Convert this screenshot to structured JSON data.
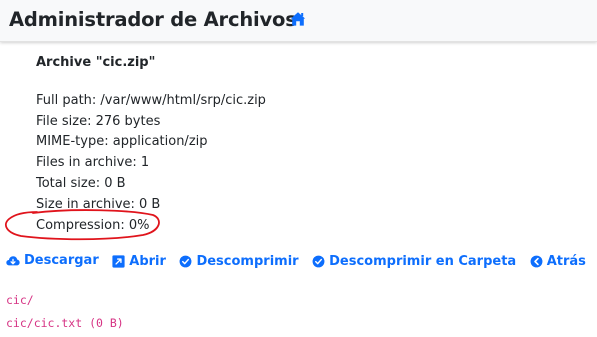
{
  "header": {
    "brand": "Administrador de Archivos",
    "home_icon": "home-icon",
    "accent_color": "#0d6efd"
  },
  "archive": {
    "title": "Archive \"cic.zip\"",
    "info": [
      "Full path: /var/www/html/srp/cic.zip",
      "File size: 276 bytes",
      "MIME-type: application/zip",
      "Files in archive: 1",
      "Total size: 0 B",
      "Size in archive: 0 B",
      "Compression: 0%"
    ]
  },
  "annotation": {
    "shape": "hand-drawn-ellipse",
    "color": "#e0141c",
    "target": "Compression: 0%"
  },
  "actions": [
    {
      "label": "Descargar",
      "icon": "cloud-download-icon"
    },
    {
      "label": "Abrir",
      "icon": "external-link-icon"
    },
    {
      "label": "Descomprimir",
      "icon": "check-circle-icon"
    },
    {
      "label": "Descomprimir en Carpeta",
      "icon": "check-circle-icon"
    },
    {
      "label": "Atrás",
      "icon": "arrow-left-circle-icon"
    }
  ],
  "files": [
    "cic/",
    "cic/cic.txt (0 B)"
  ],
  "colors": {
    "link": "#0d6efd",
    "code": "#d63384",
    "annotation": "#e0141c"
  }
}
